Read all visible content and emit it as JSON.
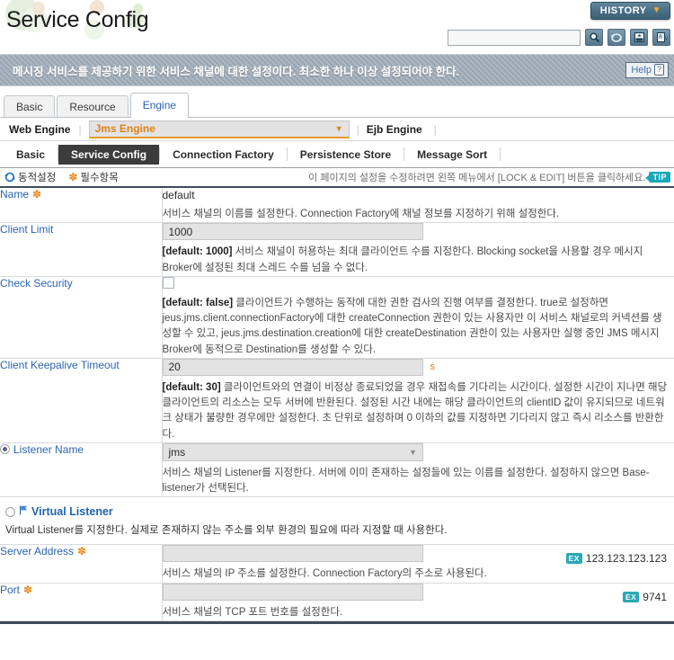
{
  "header": {
    "title": "Service Config",
    "history_label": "HISTORY",
    "history_caret": "▼",
    "search_value": "",
    "search_placeholder": "",
    "icons": [
      {
        "name": "search-icon",
        "title": "Search"
      },
      {
        "name": "refresh-icon",
        "title": "Refresh"
      },
      {
        "name": "xml-export-icon",
        "title": "XML"
      },
      {
        "name": "export-icon",
        "title": "Export"
      }
    ]
  },
  "description": {
    "text": "메시징 서비스를 제공하기 위한 서비스 채널에 대한 설정이다. 최소한 하나 이상 설정되어야 한다.",
    "help_label": "Help",
    "help_mark": "?"
  },
  "tabs_level1": [
    {
      "label": "Basic",
      "active": false
    },
    {
      "label": "Resource",
      "active": false
    },
    {
      "label": "Engine",
      "active": true
    }
  ],
  "engines": [
    {
      "label": "Web Engine",
      "selected": false,
      "caret": ""
    },
    {
      "label": "Jms Engine",
      "selected": true,
      "caret": "▼"
    },
    {
      "label": "Ejb Engine",
      "selected": false,
      "caret": ""
    }
  ],
  "tabs_level3": [
    {
      "label": "Basic",
      "active": false
    },
    {
      "label": "Service Config",
      "active": true
    },
    {
      "label": "Connection Factory",
      "active": false
    },
    {
      "label": "Persistence Store",
      "active": false
    },
    {
      "label": "Message Sort",
      "active": false
    }
  ],
  "legend": {
    "dynamic_label": "동적설정",
    "required_label": "필수항목",
    "required_mark": "✽",
    "note": "이 페이지의 설정을 수정하려면 왼쪽 메뉴에서 [LOCK & EDIT] 버튼을 클릭하세요.",
    "tip_label": "TIP"
  },
  "fields": [
    {
      "name": "name",
      "label": "Name",
      "required": true,
      "required_mark": "✽",
      "control": "text-plain",
      "value": "default",
      "hint_default": "",
      "hint": "서비스 채널의 이름를 설정한다. Connection Factory에 채널 정보를 지정하기 위해 설정한다."
    },
    {
      "name": "client-limit",
      "label": "Client Limit",
      "required": false,
      "control": "text",
      "value": "1000",
      "hint_default": "[default: 1000]",
      "hint": "서비스 채널이 허용하는 최대 클라이언트 수를 지정한다. Blocking socket을 사용할 경우 메시지 Broker에 설정된 최대 스레드 수를 넘을 수 없다."
    },
    {
      "name": "check-security",
      "label": "Check Security",
      "required": false,
      "control": "checkbox",
      "checked": false,
      "hint_default": "[default: false]",
      "hint": "클라이언트가 수행하는 동작에 대한 권한 검사의 진행 여부를 결정한다. true로 설정하면 jeus.jms.client.connectionFactory에 대한 createConnection 권한이 있는 사용자만 이 서비스 채널로의 커넥션를 생성할 수 있고, jeus.jms.destination.creation에 대한 createDestination 권한이 있는 사용자만 실행 중인 JMS 메시지 Broker에 동적으로 Destination를 생성할 수 있다."
    },
    {
      "name": "client-keepalive-timeout",
      "label": "Client Keepalive Timeout",
      "required": false,
      "control": "text",
      "value": "20",
      "unit": "s",
      "hint_default": "[default: 30]",
      "hint": "클라이언트와의 연결이 비정상 종료되었을 경우 재접속를 기다리는 시간이다. 설정한 시간이 지나면 해당 클라이언트의 리소스는 모두 서버에 반환된다. 설정된 시간 내에는 해당 클라이언트의 clientID 값이 유지되므로 네트워크 상태가 불량한 경우에만 설정한다. 초 단위로 설정하며 0 이하의 값를 지정하면 기다리지 않고 즉시 리소스를 반환한다."
    },
    {
      "name": "listener-name",
      "label": "Listener Name",
      "radio": true,
      "radio_selected": true,
      "control": "select",
      "value": "jms",
      "hint_default": "",
      "hint": "서비스 채널의 Listener를 지정한다. 서버에 이미 존재하는 설정들에 있는 이름를 설정한다. 설정하지 않으면 Base-listener가 선택된다."
    }
  ],
  "virtual_listener": {
    "radio_selected": false,
    "title": "Virtual Listener",
    "desc": "Virtual Listener를 지정한다. 실제로 존재하지 않는 주소를 외부 환경의 필요에 따라 지정할 때 사용한다."
  },
  "vl_fields": [
    {
      "name": "server-address",
      "label": "Server Address",
      "required": true,
      "required_mark": "✽",
      "control": "text",
      "value": "",
      "example_badge": "EX",
      "example": "123.123.123.123",
      "hint": "서비스 채널의 IP 주소를 설정한다. Connection Factory의 주소로 사용된다."
    },
    {
      "name": "port",
      "label": "Port",
      "required": true,
      "required_mark": "✽",
      "control": "text",
      "value": "",
      "example_badge": "EX",
      "example": "9741",
      "hint": "서비스 채널의 TCP 포트 번호를 설정한다."
    }
  ]
}
